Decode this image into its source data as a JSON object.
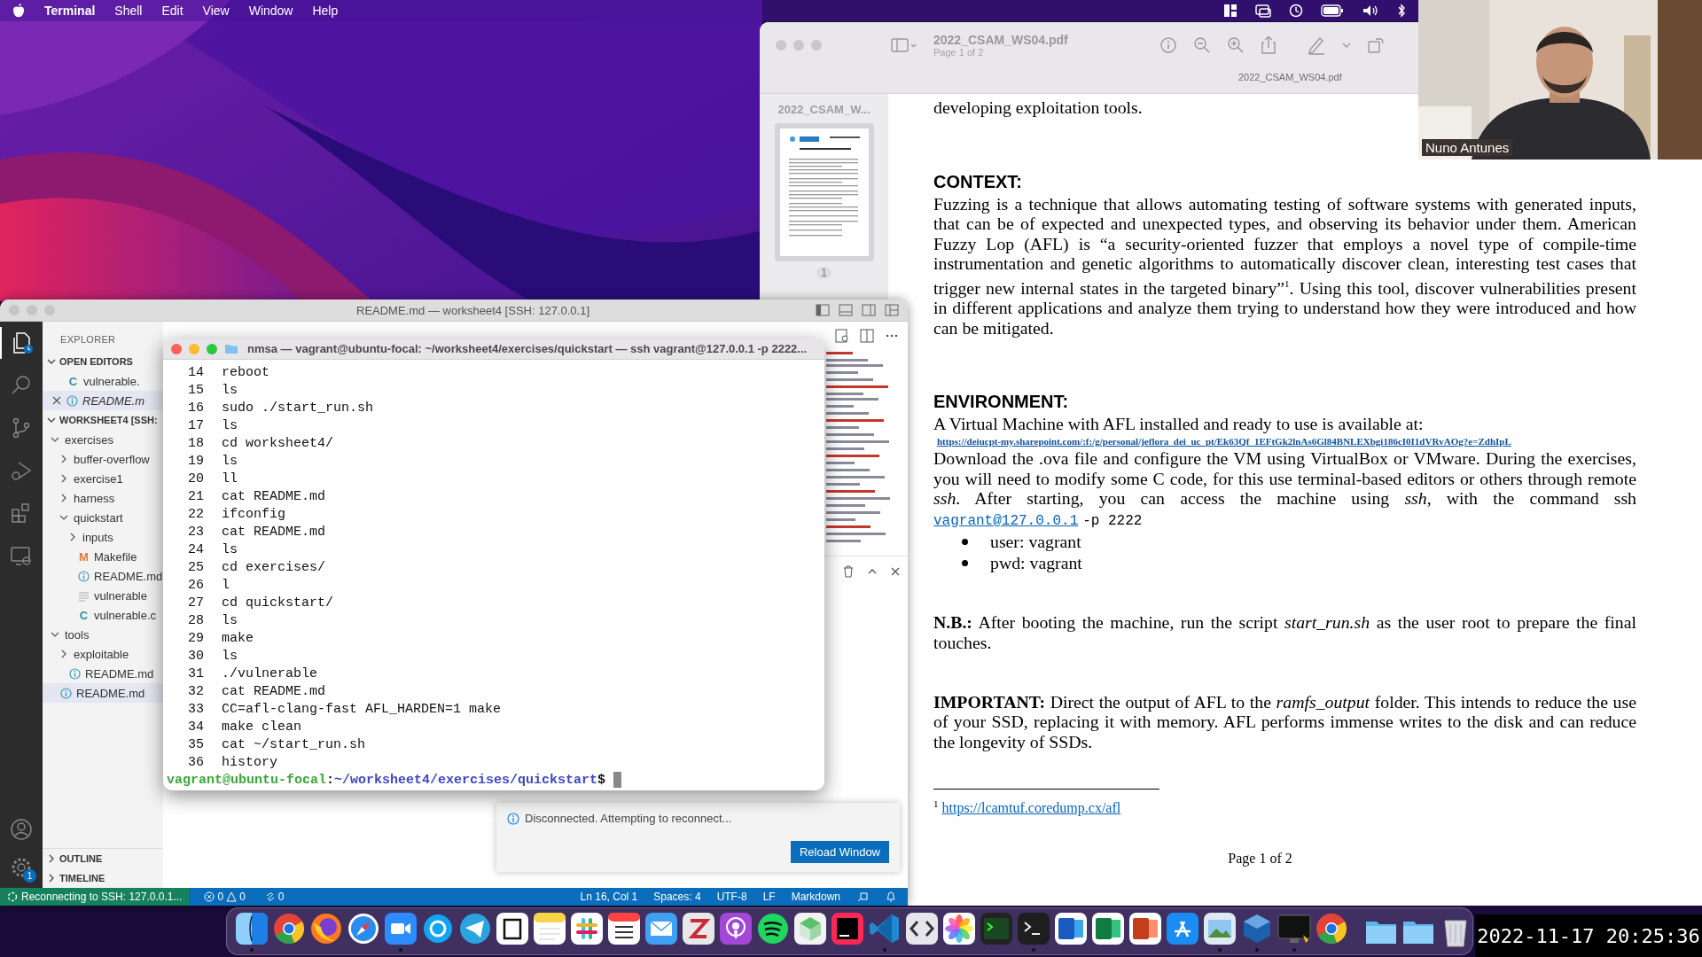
{
  "menu_bar": {
    "app": "Terminal",
    "menus": [
      "Shell",
      "Edit",
      "View",
      "Window",
      "Help"
    ]
  },
  "preview": {
    "title": "2022_CSAM_WS04.pdf",
    "subtitle": "Page 1 of 2",
    "doc_label": "2022_CSAM_WS04.pdf",
    "thumbnail_label": "2022_CSAM_W...",
    "thumbnail_page": "1",
    "page": {
      "intro_tail": "developing exploitation tools.",
      "blocks": [
        {
          "kind": "heading",
          "text": "CONTEXT:"
        },
        {
          "kind": "paragraph",
          "text": "Fuzzing is a technique that allows automating testing of software systems with generated inputs, that can be of expected and unexpected types, and observing its behavior under them. American Fuzzy Lop (AFL) is “a security-oriented fuzzer that employs a novel type of compile-time instrumentation and genetic algorithms to automatically discover clean, interesting test cases that trigger new internal states in the targeted binary”$^{1}$. Using this tool, discover vulnerabilities present in different applications and analyze them trying to understand how they were introduced and how can be mitigated."
        },
        {
          "kind": "heading",
          "text": "ENVIRONMENT:"
        },
        {
          "kind": "line",
          "text": "A Virtual Machine with AFL installed and ready to use is available at:"
        },
        {
          "kind": "link",
          "text": "https://deiucpt-my.sharepoint.com/:f:/g/personal/jeflora_dei_uc_pt/Ek63Qf_1EFtGk2lnAs6Gl84BNLEXbgi186cI0I1dVRvAOg?e=ZdhIpL"
        },
        {
          "kind": "paragraph",
          "text": "Download the .ova file and configure the VM using VirtualBox or VMware. During the exercises, you will need to modify some C code, for this use terminal-based editors or others through remote *ssh*. After starting, you can access the machine using *ssh*, with the command ssh",
          "link": "vagrant@127.0.0.1",
          "after": "-p 2222"
        },
        {
          "kind": "bullets",
          "items": [
            "user: vagrant",
            "pwd: vagrant"
          ]
        },
        {
          "kind": "note",
          "text": "**N.B.:** After booting the machine, run the script *start_run.sh* as the user root to prepare the final touches."
        },
        {
          "kind": "note",
          "text": "**IMPORTANT:** Direct the output of AFL to the *ramfs_output* folder. This intends to reduce the use of your SSD, replacing it with memory. AFL performs immense writes to the disk and can reduce the longevity of SSDs."
        }
      ],
      "footnote": {
        "mark": "1",
        "link": "https://lcamtuf.coredump.cx/afl"
      },
      "page_number": "Page 1 of 2"
    }
  },
  "webcam": {
    "name": "Nuno Antunes"
  },
  "vscode": {
    "title": "README.md — worksheet4 [SSH: 127.0.0.1]",
    "activity": [
      {
        "kind": "explorer",
        "selected": true
      },
      {
        "kind": "search",
        "selected": false
      },
      {
        "kind": "source-control",
        "selected": false
      },
      {
        "kind": "run",
        "selected": false
      },
      {
        "kind": "extensions",
        "selected": false
      },
      {
        "kind": "remote",
        "selected": false
      }
    ],
    "settings_badge": "1",
    "sidebar_title": "EXPLORER",
    "open_editors": {
      "label": "OPEN EDITORS",
      "expanded": true,
      "items": [
        {
          "name": "vulnerable.",
          "kind": "c",
          "glyph": "C",
          "preview": false,
          "selected": false
        },
        {
          "name": "README.m",
          "kind": "info",
          "preview": true,
          "selected": true
        }
      ]
    },
    "workspace": {
      "label": "WORKSHEET4 [SSH:",
      "expanded": true,
      "children": [
        {
          "name": "exercises",
          "kind": "folder",
          "expanded": true,
          "selected": false,
          "children": [
            {
              "name": "buffer-overflow",
              "kind": "folder",
              "expanded": false,
              "selected": false
            },
            {
              "name": "exercise1",
              "kind": "folder",
              "expanded": false,
              "selected": false
            },
            {
              "name": "harness",
              "kind": "folder",
              "expanded": false,
              "selected": false
            },
            {
              "name": "quickstart",
              "kind": "folder",
              "expanded": true,
              "selected": false,
              "children": [
                {
                  "name": "inputs",
                  "kind": "folder",
                  "expanded": false,
                  "selected": false
                },
                {
                  "name": "Makefile",
                  "kind": "makefile",
                  "glyph": "M",
                  "selected": false
                },
                {
                  "name": "README.md",
                  "kind": "info",
                  "selected": false
                },
                {
                  "name": "vulnerable",
                  "kind": "plain",
                  "selected": false
                },
                {
                  "name": "vulnerable.c",
                  "kind": "c",
                  "glyph": "C",
                  "selected": false
                }
              ]
            }
          ]
        },
        {
          "name": "tools",
          "kind": "folder",
          "expanded": true,
          "selected": false,
          "children": [
            {
              "name": "exploitable",
              "kind": "folder",
              "expanded": false,
              "selected": false
            },
            {
              "name": "README.md",
              "kind": "info",
              "selected": false
            }
          ]
        },
        {
          "name": "README.md",
          "kind": "info",
          "selected": true
        }
      ]
    },
    "sections": [
      {
        "label": "OUTLINE",
        "expanded": false
      },
      {
        "label": "TIMELINE",
        "expanded": false
      }
    ],
    "notification": {
      "message": "Disconnected. Attempting to reconnect...",
      "button": "Reload Window"
    },
    "status_bar": {
      "remote": "Reconnecting to SSH: 127.0.0.1...",
      "errors": "0",
      "warnings": "0",
      "ports": "0",
      "items": [
        "Ln 16, Col 1",
        "Spaces: 4",
        "UTF-8",
        "LF",
        "Markdown"
      ]
    }
  },
  "terminal": {
    "title": "nmsa — vagrant@ubuntu-focal: ~/worksheet4/exercises/quickstart — ssh vagrant@127.0.0.1 -p 2222...",
    "history": [
      {
        "n": "14",
        "cmd": "reboot"
      },
      {
        "n": "15",
        "cmd": "ls"
      },
      {
        "n": "16",
        "cmd": "sudo ./start_run.sh"
      },
      {
        "n": "17",
        "cmd": "ls"
      },
      {
        "n": "18",
        "cmd": "cd worksheet4/"
      },
      {
        "n": "19",
        "cmd": "ls"
      },
      {
        "n": "20",
        "cmd": "ll"
      },
      {
        "n": "21",
        "cmd": "cat README.md"
      },
      {
        "n": "22",
        "cmd": "ifconfig"
      },
      {
        "n": "23",
        "cmd": "cat README.md"
      },
      {
        "n": "24",
        "cmd": "ls"
      },
      {
        "n": "25",
        "cmd": "cd exercises/"
      },
      {
        "n": "26",
        "cmd": "l"
      },
      {
        "n": "27",
        "cmd": "cd quickstart/"
      },
      {
        "n": "28",
        "cmd": "ls"
      },
      {
        "n": "29",
        "cmd": "make"
      },
      {
        "n": "30",
        "cmd": "ls"
      },
      {
        "n": "31",
        "cmd": "./vulnerable"
      },
      {
        "n": "32",
        "cmd": "cat README.md"
      },
      {
        "n": "33",
        "cmd": "CC=afl-clang-fast AFL_HARDEN=1 make"
      },
      {
        "n": "34",
        "cmd": "make clean"
      },
      {
        "n": "35",
        "cmd": "cat ~/start_run.sh"
      },
      {
        "n": "36",
        "cmd": "history"
      }
    ],
    "prompt": {
      "user_host": "vagrant@ubuntu-focal",
      "sep": ":",
      "path": "~/worksheet4/exercises/quickstart",
      "symbol": "$"
    }
  },
  "dock": {
    "apps": [
      {
        "kind": "finder",
        "running": true
      },
      {
        "kind": "chrome",
        "running": false
      },
      {
        "kind": "firefox",
        "running": false
      },
      {
        "kind": "safari",
        "running": false
      },
      {
        "kind": "zoom",
        "running": true
      },
      {
        "kind": "skype",
        "running": false
      },
      {
        "kind": "telegram",
        "running": false
      },
      {
        "kind": "notion",
        "running": false
      },
      {
        "kind": "notes",
        "running": false
      },
      {
        "kind": "slack",
        "running": false
      },
      {
        "kind": "calendar",
        "running": false
      },
      {
        "kind": "mail",
        "running": false
      },
      {
        "kind": "zotero",
        "running": false
      },
      {
        "kind": "podcasts",
        "running": false
      },
      {
        "kind": "spotify",
        "running": false
      },
      {
        "kind": "cube",
        "running": false
      },
      {
        "kind": "intellij",
        "running": false
      },
      {
        "kind": "vscode",
        "running": true
      },
      {
        "kind": "xcode",
        "running": false
      },
      {
        "kind": "photos",
        "running": false
      },
      {
        "kind": "iterm",
        "running": false
      },
      {
        "kind": "terminal",
        "running": true
      },
      {
        "kind": "word",
        "running": false
      },
      {
        "kind": "excel",
        "running": false
      },
      {
        "kind": "powerpoint",
        "running": false
      },
      {
        "kind": "appstore",
        "running": false
      },
      {
        "kind": "preview",
        "running": true
      },
      {
        "kind": "virtualbox",
        "running": true
      },
      {
        "kind": "monitor",
        "running": true
      },
      {
        "kind": "chrome",
        "running": false
      }
    ],
    "stacks": [
      {
        "kind": "folder"
      },
      {
        "kind": "folder"
      },
      {
        "kind": "trash"
      }
    ]
  },
  "clock": "2022-11-17 20:25:36"
}
